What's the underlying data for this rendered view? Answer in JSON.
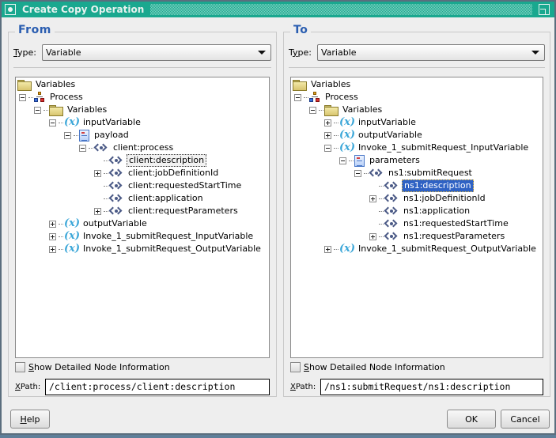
{
  "window": {
    "title": "Create Copy Operation"
  },
  "from": {
    "legend": "From",
    "type_label_pre": "",
    "type_label_mn": "T",
    "type_label_post": "ype:",
    "type_value": "Variable",
    "tree": [
      {
        "label": "Variables",
        "icon": "folder-icon",
        "level": 0,
        "expander": "none"
      },
      {
        "label": "Process",
        "icon": "process-icon",
        "level": 1,
        "expander": "minus"
      },
      {
        "label": "Variables",
        "icon": "folder-icon",
        "level": 2,
        "expander": "minus"
      },
      {
        "label": "inputVariable",
        "icon": "variable-icon",
        "level": 3,
        "expander": "minus"
      },
      {
        "label": "payload",
        "icon": "message-part-icon",
        "level": 4,
        "expander": "minus"
      },
      {
        "label": "client:process",
        "icon": "element-icon",
        "level": 5,
        "expander": "minus"
      },
      {
        "label": "client:description",
        "icon": "element-icon",
        "level": 6,
        "expander": "none",
        "state": "focused"
      },
      {
        "label": "client:jobDefinitionId",
        "icon": "element-icon",
        "level": 6,
        "expander": "plus"
      },
      {
        "label": "client:requestedStartTime",
        "icon": "element-icon",
        "level": 6,
        "expander": "none"
      },
      {
        "label": "client:application",
        "icon": "element-icon",
        "level": 6,
        "expander": "none"
      },
      {
        "label": "client:requestParameters",
        "icon": "element-icon",
        "level": 6,
        "expander": "plus"
      },
      {
        "label": "outputVariable",
        "icon": "variable-icon",
        "level": 3,
        "expander": "plus"
      },
      {
        "label": "Invoke_1_submitRequest_InputVariable",
        "icon": "variable-icon",
        "level": 3,
        "expander": "plus"
      },
      {
        "label": "Invoke_1_submitRequest_OutputVariable",
        "icon": "variable-icon",
        "level": 3,
        "expander": "plus"
      }
    ],
    "show_detail_mn": "S",
    "show_detail_rest": "how Detailed Node Information",
    "show_detail_checked": false,
    "xpath_label_mn": "X",
    "xpath_label_rest": "Path:",
    "xpath_value": "/client:process/client:description"
  },
  "to": {
    "legend": "To",
    "type_label_pre": "T",
    "type_label_mn": "y",
    "type_label_post": "pe:",
    "type_value": "Variable",
    "tree": [
      {
        "label": "Variables",
        "icon": "folder-icon",
        "level": 0,
        "expander": "none"
      },
      {
        "label": "Process",
        "icon": "process-icon",
        "level": 1,
        "expander": "minus"
      },
      {
        "label": "Variables",
        "icon": "folder-icon",
        "level": 2,
        "expander": "minus"
      },
      {
        "label": "inputVariable",
        "icon": "variable-icon",
        "level": 3,
        "expander": "plus"
      },
      {
        "label": "outputVariable",
        "icon": "variable-icon",
        "level": 3,
        "expander": "plus"
      },
      {
        "label": "Invoke_1_submitRequest_InputVariable",
        "icon": "variable-icon",
        "level": 3,
        "expander": "minus"
      },
      {
        "label": "parameters",
        "icon": "message-part-icon",
        "level": 4,
        "expander": "minus"
      },
      {
        "label": "ns1:submitRequest",
        "icon": "element-icon",
        "level": 5,
        "expander": "minus"
      },
      {
        "label": "ns1:description",
        "icon": "element-icon",
        "level": 6,
        "expander": "none",
        "state": "selected"
      },
      {
        "label": "ns1:jobDefinitionId",
        "icon": "element-icon",
        "level": 6,
        "expander": "plus"
      },
      {
        "label": "ns1:application",
        "icon": "element-icon",
        "level": 6,
        "expander": "none"
      },
      {
        "label": "ns1:requestedStartTime",
        "icon": "element-icon",
        "level": 6,
        "expander": "none"
      },
      {
        "label": "ns1:requestParameters",
        "icon": "element-icon",
        "level": 6,
        "expander": "plus"
      },
      {
        "label": "Invoke_1_submitRequest_OutputVariable",
        "icon": "variable-icon",
        "level": 3,
        "expander": "plus"
      }
    ],
    "show_detail_mn": "S",
    "show_detail_rest": "how Detailed Node Information",
    "show_detail_checked": false,
    "xpath_label_mn": "X",
    "xpath_label_rest": "Path:",
    "xpath_value": "/ns1:submitRequest/ns1:description"
  },
  "buttons": {
    "help_mn": "H",
    "help_rest": "elp",
    "ok": "OK",
    "cancel": "Cancel"
  },
  "colors": {
    "titlebar": "#1aa88f",
    "legend": "#2a5db0",
    "selection": "#2f62c4"
  }
}
